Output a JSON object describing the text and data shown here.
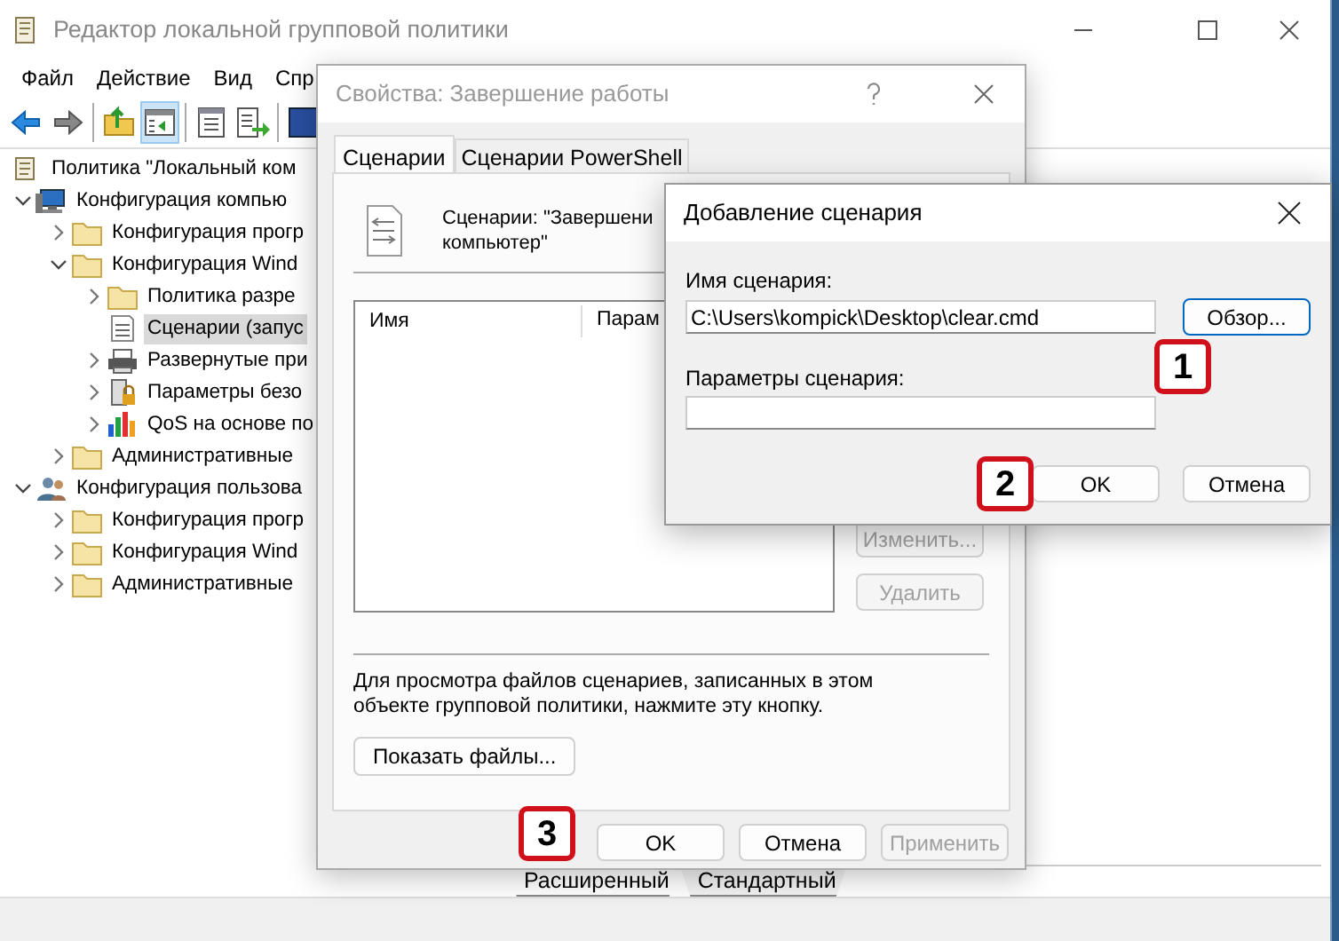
{
  "main_window": {
    "title": "Редактор локальной групповой политики",
    "menu": [
      "Файл",
      "Действие",
      "Вид",
      "Спр"
    ],
    "toolbar": [
      {
        "kind": "back",
        "pressed": false
      },
      {
        "kind": "forward",
        "pressed": false
      },
      {
        "kind": "sep"
      },
      {
        "kind": "up",
        "pressed": false
      },
      {
        "kind": "tree",
        "pressed": true
      },
      {
        "kind": "sep"
      },
      {
        "kind": "properties",
        "pressed": false
      },
      {
        "kind": "export",
        "pressed": false
      },
      {
        "kind": "sep"
      },
      {
        "kind": "help"
      }
    ],
    "tree": [
      {
        "label": "Политика \"Локальный ком",
        "kind": "doc",
        "selected": false,
        "children": [
          {
            "label": "Конфигурация компью",
            "kind": "computer",
            "expanded": true,
            "selected": false,
            "children": [
              {
                "label": "Конфигурация прогр",
                "kind": "folder",
                "expanded": false,
                "selected": false
              },
              {
                "label": "Конфигурация Wind",
                "kind": "folder",
                "expanded": true,
                "selected": false,
                "children": [
                  {
                    "label": "Политика разре",
                    "kind": "folder",
                    "expanded": false,
                    "selected": false
                  },
                  {
                    "label": "Сценарии (запус",
                    "kind": "script",
                    "selected": true
                  },
                  {
                    "label": "Развернутые при",
                    "kind": "printer",
                    "expanded": false,
                    "selected": false
                  },
                  {
                    "label": "Параметры безо",
                    "kind": "security",
                    "expanded": false,
                    "selected": false
                  },
                  {
                    "label": "QoS на основе по",
                    "kind": "chart",
                    "expanded": false,
                    "selected": false
                  }
                ]
              },
              {
                "label": "Административные",
                "kind": "folder",
                "expanded": false,
                "selected": false
              }
            ]
          },
          {
            "label": "Конфигурация пользова",
            "kind": "user",
            "expanded": true,
            "selected": false,
            "children": [
              {
                "label": "Конфигурация прогр",
                "kind": "folder",
                "expanded": false,
                "selected": false
              },
              {
                "label": "Конфигурация Wind",
                "kind": "folder",
                "expanded": false,
                "selected": false
              },
              {
                "label": "Административные",
                "kind": "folder",
                "expanded": false,
                "selected": false
              }
            ]
          }
        ]
      }
    ],
    "view_tabs": [
      {
        "label": "Расширенный",
        "selected": true
      },
      {
        "label": "Стандартный",
        "selected": false
      }
    ]
  },
  "properties_dialog": {
    "title": "Свойства: Завершение работы",
    "tabs": [
      {
        "label": "Сценарии",
        "selected": true
      },
      {
        "label": "Сценарии PowerShell",
        "selected": false
      }
    ],
    "header_lines": [
      "Сценарии: \"Завершени",
      "компьютер\""
    ],
    "columns": [
      "Имя",
      "Парам"
    ],
    "side_buttons": [
      "Изменить...",
      "Удалить"
    ],
    "note": "Для просмотра файлов сценариев, записанных в этом объекте групповой политики, нажмите эту кнопку.",
    "show_files_button": "Показать файлы...",
    "buttons": [
      {
        "label": "OK",
        "disabled": false
      },
      {
        "label": "Отмена",
        "disabled": false
      },
      {
        "label": "Применить",
        "disabled": true
      }
    ]
  },
  "add_dialog": {
    "title": "Добавление сценария",
    "name_label": "Имя сценария:",
    "name_value": "C:\\Users\\kompick\\Desktop\\clear.cmd",
    "browse_button": {
      "label": "Обзор...",
      "focused": true
    },
    "params_label": "Параметры сценария:",
    "buttons": [
      "OK",
      "Отмена"
    ]
  },
  "step_markers": [
    "1",
    "2",
    "3"
  ]
}
